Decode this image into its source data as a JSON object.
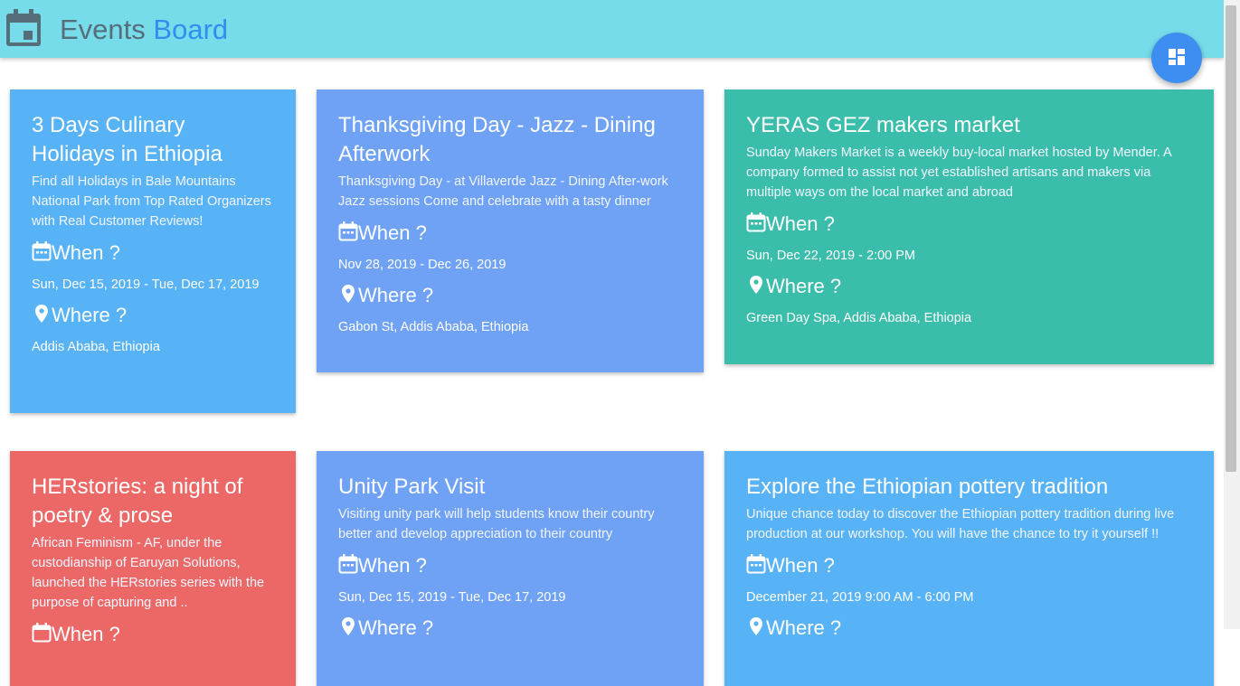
{
  "header": {
    "title_part1": "Events",
    "title_part2": "Board",
    "icon": "calendar-icon",
    "background": "#77dcea",
    "accent": "#2f8ef0"
  },
  "fab": {
    "icon": "dashboard-icon",
    "color": "#3d8ef0"
  },
  "labels": {
    "when": "When ?",
    "where": "Where ?"
  },
  "events": [
    {
      "title": "3 Days Culinary Holidays in Ethiopia",
      "description": "Find all Holidays in Bale Mountains National Park from Top Rated Organizers with Real Customer Reviews!",
      "date": "Sun, Dec 15, 2019 - Tue, Dec 17, 2019",
      "location": "Addis Ababa, Ethiopia",
      "color": "#58b3f6"
    },
    {
      "title": "Thanksgiving Day - Jazz - Dining Afterwork",
      "description": "Thanksgiving Day - at Villaverde Jazz - Dining After-work Jazz sessions Come and celebrate with a tasty dinner",
      "date": "Nov 28, 2019 - Dec 26, 2019",
      "location": "Gabon St, Addis Ababa, Ethiopia",
      "color": "#6fa2f4"
    },
    {
      "title": "YERAS GEZ makers market",
      "description": "Sunday Makers Market is a weekly buy-local market hosted by Mender. A company formed to assist not yet established artisans and makers via multiple ways om the local market and abroad",
      "date": "Sun, Dec 22, 2019 - 2:00 PM",
      "location": "Green Day Spa, Addis Ababa, Ethiopia",
      "color": "#3bbdac"
    },
    {
      "title": "HERstories: a night of poetry & prose",
      "description": "African Feminism - AF, under the custodianship of Earuyan Solutions, launched the HERstories series with the purpose of capturing and ..",
      "date": "",
      "location": "",
      "color": "#eb6867"
    },
    {
      "title": "Unity Park Visit",
      "description": "Visiting unity park will help students know their country better and develop appreciation to their country",
      "date": "Sun, Dec 15, 2019 - Tue, Dec 17, 2019",
      "location": "",
      "color": "#6fa2f4"
    },
    {
      "title": "Explore the Ethiopian pottery tradition",
      "description": "Unique chance today to discover the Ethiopian pottery tradition during live production at our workshop. You will have the chance to try it yourself !!",
      "date": "December 21, 2019 9:00 AM - 6:00 PM",
      "location": "",
      "color": "#58b3f6"
    }
  ]
}
